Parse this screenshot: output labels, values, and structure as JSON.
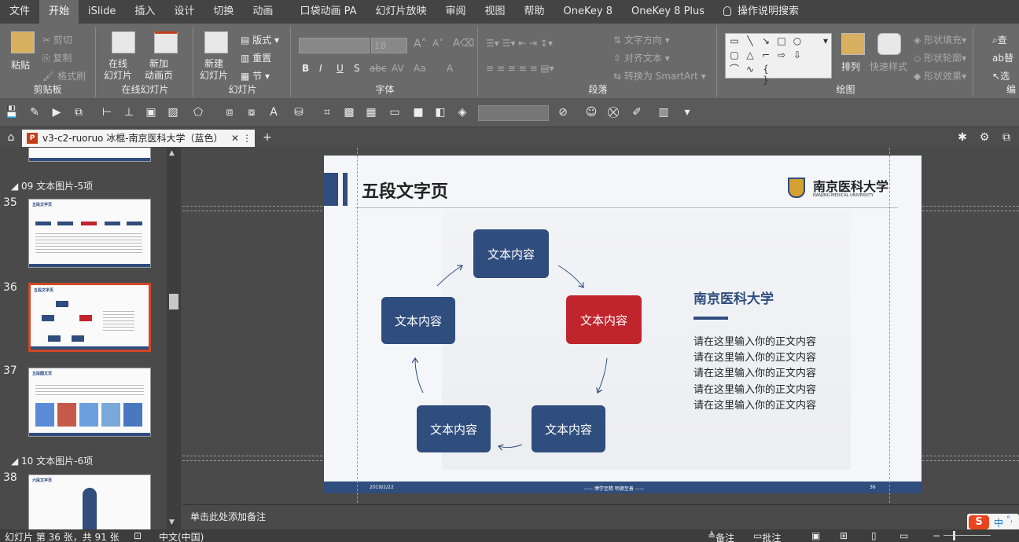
{
  "menu": {
    "items": [
      "文件",
      "开始",
      "iSlide",
      "插入",
      "设计",
      "切换",
      "动画",
      "口袋动画 PA",
      "幻灯片放映",
      "审阅",
      "视图",
      "帮助",
      "OneKey 8",
      "OneKey 8 Plus"
    ],
    "active": "开始",
    "tell_me": "操作说明搜索"
  },
  "ribbon": {
    "clipboard": {
      "paste": "粘贴",
      "cut": "剪切",
      "copy": "复制",
      "format_painter": "格式刷",
      "label": "剪贴板"
    },
    "online_slides": {
      "online": "在线\n幻灯片",
      "new_anim": "新加\n动画页",
      "label": "在线幻灯片"
    },
    "slides": {
      "new_slide": "新建\n幻灯片",
      "layout": "版式",
      "reset": "重置",
      "section": "节",
      "label": "幻灯片"
    },
    "font": {
      "font_size": "18",
      "label": "字体",
      "buttons": [
        "B",
        "I",
        "U",
        "S",
        "abc",
        "AV",
        "Aa",
        "A"
      ]
    },
    "paragraph": {
      "text_direction": "文字方向",
      "align_text": "对齐文本",
      "smartart": "转换为 SmartArt",
      "label": "段落"
    },
    "drawing": {
      "arrange": "排列",
      "quick_styles": "快速样式",
      "fill": "形状填充",
      "outline": "形状轮廓",
      "effects": "形状效果",
      "label": "绘图"
    },
    "editing": {
      "find": "查",
      "replace": "替",
      "select": "选",
      "label": "编"
    }
  },
  "tab": {
    "title": "v3-c2-ruoruo 冰棍-南京医科大学（蓝色）"
  },
  "thumbnails": {
    "section_09": "09 文本图片-5项",
    "section_10": "10 文本图片-6项",
    "slides": [
      {
        "num": "35",
        "head": "五段文字页"
      },
      {
        "num": "36",
        "head": "五段文字页"
      },
      {
        "num": "37",
        "head": "五段图文页"
      },
      {
        "num": "38",
        "head": "六段文字页"
      }
    ]
  },
  "slide": {
    "title": "五段文字页",
    "logo_text": "南京医科大学",
    "logo_sub": "NANJING MEDICAL UNIVERSITY",
    "boxes": [
      "文本内容",
      "文本内容",
      "文本内容",
      "文本内容",
      "文本内容"
    ],
    "right_title": "南京医科大学",
    "body_lines": [
      "请在这里输入你的正文内容",
      "请在这里输入你的正文内容",
      "请在这里输入你的正文内容",
      "请在这里输入你的正文内容",
      "请在这里输入你的正文内容"
    ],
    "footer_date": "2019/2/22",
    "footer_motto": "—— 博学至精  明德至善 ——",
    "footer_page": "36"
  },
  "notes": {
    "placeholder": "单击此处添加备注"
  },
  "status": {
    "slide_info": "幻灯片 第 36 张，共 91 张",
    "language": "中文(中国)",
    "notes_btn": "备注",
    "comments_btn": "批注"
  },
  "ime": {
    "mode": "中"
  },
  "colors": {
    "navy": "#2f4d7d",
    "red": "#c0242c",
    "accent_orange": "#d24726"
  }
}
